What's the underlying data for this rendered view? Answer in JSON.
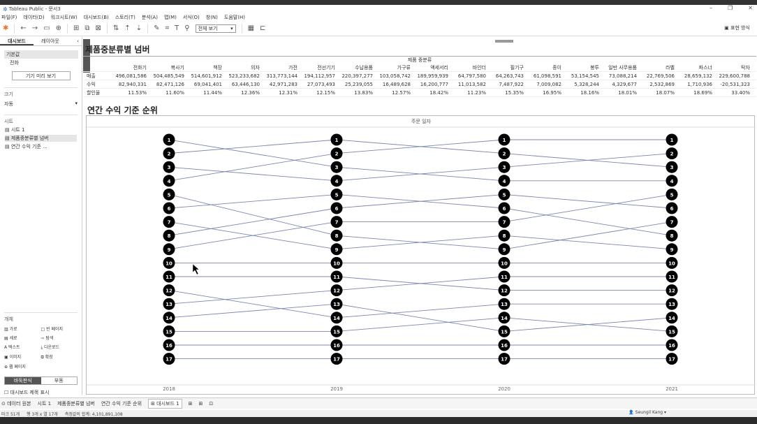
{
  "window": {
    "title": "Tableau Public - 문서3"
  },
  "menu": [
    "파일(F)",
    "데이터(D)",
    "워크시트(W)",
    "대시보드(B)",
    "스토리(T)",
    "분석(A)",
    "맵(M)",
    "서식(O)",
    "창(N)",
    "도움말(H)"
  ],
  "toolbar": {
    "view_select": "전체 보기",
    "present": "표현 방식"
  },
  "sidebar": {
    "tabs": [
      "대시보드",
      "레이아웃"
    ],
    "device": [
      "기본값",
      "전화"
    ],
    "preview_button": "기기 미리 보기",
    "size_header": "크기",
    "size_value": "자동",
    "sheets_header": "시트",
    "sheets": [
      "시트 1",
      "제품중분류별 넘버",
      "연간 수익 기준 ..."
    ],
    "objects_header": "개체",
    "objects": [
      "가로",
      "빈 페이지",
      "세로",
      "탐색",
      "텍스트",
      "다운로드",
      "이미지",
      "확장",
      "웹 페이지"
    ],
    "seg": [
      "바둑판식",
      "부동"
    ],
    "show_title": "대시보드 제목 표시"
  },
  "dashboard": {
    "title1": "제품중분류별 넘버",
    "cat_header": "제품 중분류",
    "row_labels": [
      "매출",
      "수익",
      "할인율"
    ],
    "columns": [
      "전화기",
      "복사기",
      "책장",
      "의자",
      "가전",
      "전선기기",
      "수납용품",
      "가구류",
      "액세서리",
      "바인더",
      "필기구",
      "종이",
      "봉투",
      "일반 사무용품",
      "라벨",
      "파스너",
      "탁자"
    ],
    "sales": [
      "496,081,586",
      "504,485,549",
      "514,601,912",
      "523,233,682",
      "313,773,144",
      "194,112,957",
      "220,397,277",
      "103,058,742",
      "189,959,939",
      "64,797,580",
      "64,263,743",
      "61,098,591",
      "53,154,545",
      "73,088,214",
      "22,769,506",
      "28,659,132",
      "229,600,788"
    ],
    "profit": [
      "82,940,331",
      "82,471,126",
      "69,041,401",
      "63,446,130",
      "42,971,283",
      "27,073,493",
      "25,239,055",
      "16,489,628",
      "16,200,777",
      "11,013,582",
      "7,487,922",
      "7,009,082",
      "5,328,244",
      "4,329,677",
      "2,532,869",
      "1,710,936",
      "-20,531,323"
    ],
    "discount": [
      "11.53%",
      "11.60%",
      "11.44%",
      "12.36%",
      "12.31%",
      "12.15%",
      "13.83%",
      "12.57%",
      "18.42%",
      "11.23%",
      "15.35%",
      "16.95%",
      "18.16%",
      "18.01%",
      "18.07%",
      "18.69%",
      "33.40%"
    ],
    "title2": "연간 수익 기준 순위",
    "chart_header": "주문 일자"
  },
  "chart_data": {
    "type": "line",
    "x": [
      "2018",
      "2019",
      "2020",
      "2021"
    ],
    "title": "연간 수익 기준 순위",
    "xlabel": "주문 일자",
    "ranks": [
      1,
      2,
      3,
      4,
      5,
      6,
      7,
      8,
      9,
      10,
      11,
      12,
      13,
      14,
      15,
      16,
      17
    ],
    "rank_paths": [
      [
        1,
        3,
        4,
        4
      ],
      [
        2,
        1,
        2,
        3
      ],
      [
        3,
        4,
        3,
        2
      ],
      [
        4,
        2,
        1,
        1
      ],
      [
        5,
        8,
        9,
        7
      ],
      [
        6,
        5,
        6,
        8
      ],
      [
        7,
        9,
        8,
        9
      ],
      [
        8,
        6,
        5,
        6
      ],
      [
        9,
        7,
        7,
        5
      ],
      [
        10,
        10,
        10,
        10
      ],
      [
        11,
        11,
        12,
        12
      ],
      [
        12,
        14,
        13,
        13
      ],
      [
        13,
        12,
        11,
        11
      ],
      [
        14,
        13,
        15,
        14
      ],
      [
        15,
        15,
        14,
        15
      ],
      [
        16,
        16,
        16,
        16
      ],
      [
        17,
        17,
        17,
        17
      ]
    ],
    "colors": {
      "line": "#7b86b0",
      "node": "#000000",
      "label": "#ffffff"
    }
  },
  "bottom_tabs": [
    "데이터 원본",
    "시트 1",
    "제품중분류별 넘버",
    "연간 수익 기준 순위",
    "대시보드 1"
  ],
  "status": {
    "left": "마크 51개",
    "dims": "행 3개 x 열 17개",
    "sum": "측정값의 합계: 4,101,891,108",
    "user": "Seungil Kang"
  }
}
